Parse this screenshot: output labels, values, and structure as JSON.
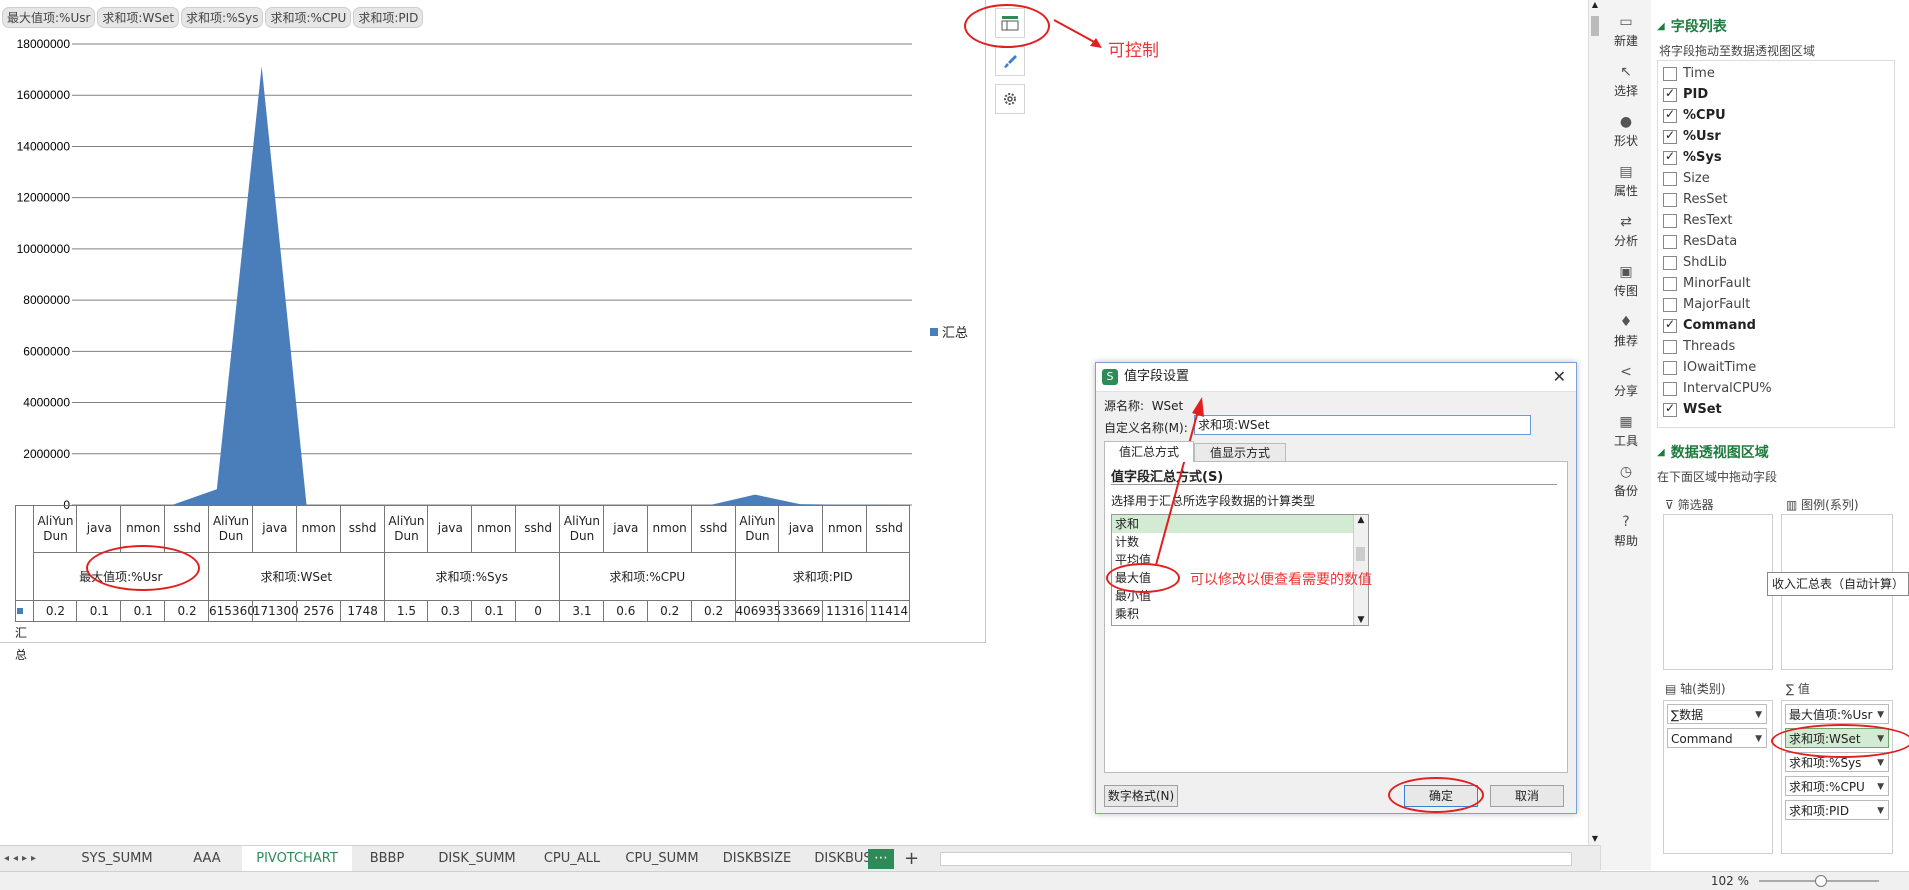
{
  "chart": {
    "field_buttons": [
      "最大值项:%Usr",
      "求和项:WSet",
      "求和项:%Sys",
      "求和项:%CPU",
      "求和项:PID"
    ],
    "legend_label": "汇总"
  },
  "chart_data": {
    "type": "area",
    "series": [
      {
        "name": "汇总",
        "values": [
          0.2,
          0.1,
          0.1,
          0.2,
          615360,
          17130000,
          2576,
          1748,
          1.5,
          0.3,
          0.1,
          0,
          3.1,
          0.6,
          0.2,
          0.2,
          406935,
          33669,
          11316,
          11414
        ]
      }
    ],
    "y_ticks": [
      "0",
      "2000000",
      "4000000",
      "6000000",
      "8000000",
      "10000000",
      "12000000",
      "14000000",
      "16000000",
      "18000000"
    ],
    "ylim": [
      0,
      18000000
    ],
    "legend_position": "right",
    "grid": true
  },
  "table": {
    "commands": [
      "AliYun Dun",
      "java",
      "nmon",
      "sshd"
    ],
    "groups": [
      {
        "label": "最大值项:%Usr",
        "values": [
          "0.2",
          "0.1",
          "0.1",
          "0.2"
        ]
      },
      {
        "label": "求和项:WSet",
        "values": [
          "615360",
          "171300",
          "2576",
          "1748"
        ]
      },
      {
        "label": "求和项:%Sys",
        "values": [
          "1.5",
          "0.3",
          "0.1",
          "0"
        ]
      },
      {
        "label": "求和项:%CPU",
        "values": [
          "3.1",
          "0.6",
          "0.2",
          "0.2"
        ]
      },
      {
        "label": "求和项:PID",
        "values": [
          "406935",
          "33669",
          "11316",
          "11414"
        ]
      }
    ],
    "row_label": "汇总"
  },
  "annotations": {
    "control": "可控制",
    "modify": "可以修改以便查看需要的数值"
  },
  "sidebar": {
    "items": [
      "新建",
      "选择",
      "形状",
      "属性",
      "分析",
      "传图",
      "推荐",
      "分享",
      "工具",
      "备份",
      "帮助"
    ]
  },
  "field_list": {
    "title": "字段列表",
    "hint": "将字段拖动至数据透视图区域",
    "fields": [
      {
        "name": "Time",
        "checked": false
      },
      {
        "name": "PID",
        "checked": true
      },
      {
        "name": "%CPU",
        "checked": true
      },
      {
        "name": "%Usr",
        "checked": true
      },
      {
        "name": "%Sys",
        "checked": true
      },
      {
        "name": "Size",
        "checked": false
      },
      {
        "name": "ResSet",
        "checked": false
      },
      {
        "name": "ResText",
        "checked": false
      },
      {
        "name": "ResData",
        "checked": false
      },
      {
        "name": "ShdLib",
        "checked": false
      },
      {
        "name": "MinorFault",
        "checked": false
      },
      {
        "name": "MajorFault",
        "checked": false
      },
      {
        "name": "Command",
        "checked": true
      },
      {
        "name": "Threads",
        "checked": false
      },
      {
        "name": "IOwaitTime",
        "checked": false
      },
      {
        "name": "IntervalCPU%",
        "checked": false
      },
      {
        "name": "WSet",
        "checked": true
      }
    ]
  },
  "pivot_areas": {
    "title": "数据透视图区域",
    "hint": "在下面区域中拖动字段",
    "filter_label": "筛选器",
    "legend_label": "图例(系列)",
    "axis_label": "轴(类别)",
    "values_label": "值",
    "axis_items": [
      "∑数据",
      "Command"
    ],
    "value_items": [
      "最大值项:%Usr",
      "求和项:WSet",
      "求和项:%Sys",
      "求和项:%CPU",
      "求和项:PID"
    ],
    "tooltip": "收入汇总表（自动计算）"
  },
  "dialog": {
    "title": "值字段设置",
    "source_label": "源名称:",
    "source_value": "WSet",
    "custom_label": "自定义名称(M):",
    "custom_value": "求和项:WSet",
    "tab1": "值汇总方式",
    "tab2": "值显示方式",
    "section": "值字段汇总方式(S)",
    "prompt": "选择用于汇总所选字段数据的计算类型",
    "options": [
      "求和",
      "计数",
      "平均值",
      "最大值",
      "最小值",
      "乘积"
    ],
    "number_format": "数字格式(N)",
    "ok": "确定",
    "cancel": "取消"
  },
  "tabs": [
    "SYS_SUMM",
    "AAA",
    "PIVOTCHART",
    "BBBP",
    "DISK_SUMM",
    "CPU_ALL",
    "CPU_SUMM",
    "DISKBSIZE",
    "DISKBUSY"
  ],
  "active_tab": "PIVOTCHART",
  "status": {
    "zoom": "102 %"
  },
  "colors": {
    "series": "#4a7ebb",
    "accent": "#1e7b3e",
    "annotation": "#e21f1f",
    "tab_active": "#2e8b57"
  }
}
